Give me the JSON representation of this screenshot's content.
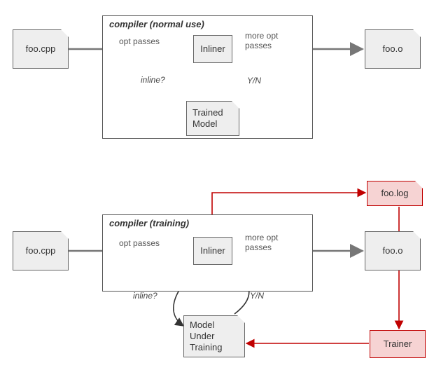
{
  "top": {
    "input_file": "foo.cpp",
    "panel_title": "compiler (normal use)",
    "opt_passes": "opt passes",
    "inliner": "Inliner",
    "more_opt_passes": "more opt\npasses",
    "inline_q": "inline?",
    "yn": "Y/N",
    "model": "Trained\nModel",
    "output_file": "foo.o"
  },
  "bottom": {
    "input_file": "foo.cpp",
    "panel_title": "compiler (training)",
    "opt_passes": "opt passes",
    "inliner": "Inliner",
    "more_opt_passes": "more opt\npasses",
    "inline_q": "inline?",
    "yn": "Y/N",
    "model": "Model\nUnder\nTraining",
    "output_file": "foo.o",
    "log_file": "foo.log",
    "trainer": "Trainer"
  }
}
